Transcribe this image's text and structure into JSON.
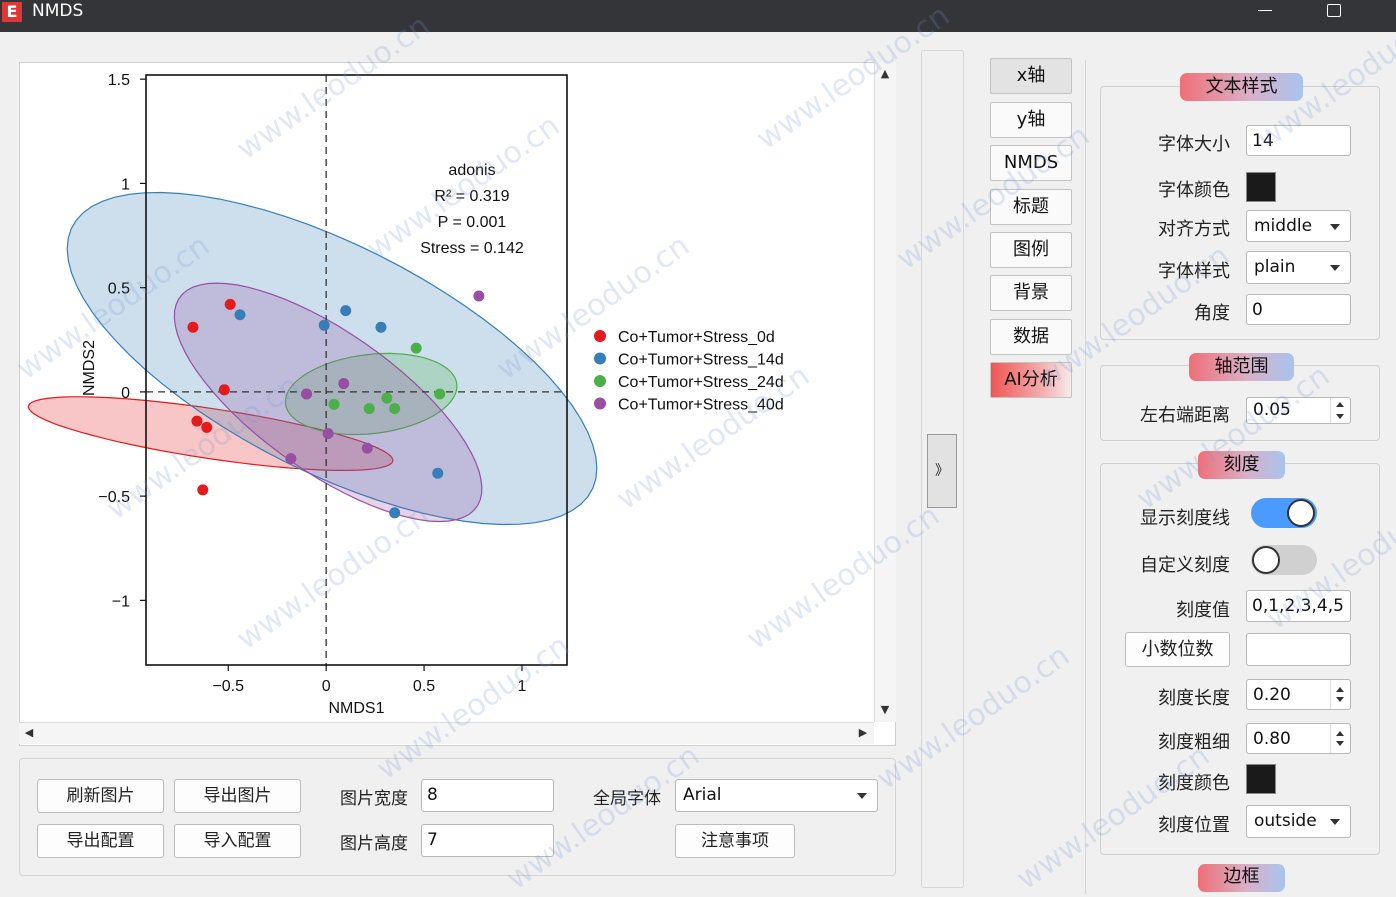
{
  "window": {
    "logo": "E",
    "title": "NMDS"
  },
  "chart_data": {
    "type": "scatter",
    "xlabel": "NMDS1",
    "ylabel": "NMDS2",
    "xlim": [
      -0.92,
      1.23
    ],
    "ylim": [
      -1.31,
      1.52
    ],
    "xticks": [
      -0.5,
      0,
      0.5,
      1
    ],
    "xtick_labels": [
      "−0.5",
      "0",
      "0.5",
      "1"
    ],
    "yticks": [
      -1,
      -0.5,
      0,
      0.5,
      1,
      1.5
    ],
    "ytick_labels": [
      "−1",
      "−0.5",
      "0",
      "0.5",
      "1",
      "1.5"
    ],
    "annotation": [
      "adonis",
      "R² = 0.319",
      "P = 0.001",
      "Stress = 0.142"
    ],
    "series": [
      {
        "name": "Co+Tumor+Stress_0d",
        "color": "#e41a1c",
        "points": [
          [
            -0.68,
            0.31
          ],
          [
            -0.49,
            0.42
          ],
          [
            -0.52,
            0.01
          ],
          [
            -0.66,
            -0.14
          ],
          [
            -0.61,
            -0.17
          ],
          [
            -0.63,
            -0.47
          ]
        ],
        "ellipse": {
          "cx": -0.59,
          "cy": -0.2,
          "rx": 0.12,
          "ry": 0.94,
          "angle": 82
        }
      },
      {
        "name": "Co+Tumor+Stress_14d",
        "color": "#377eb8",
        "points": [
          [
            -0.44,
            0.37
          ],
          [
            -0.01,
            0.32
          ],
          [
            0.1,
            0.39
          ],
          [
            0.28,
            0.31
          ],
          [
            0.57,
            -0.39
          ],
          [
            0.35,
            -0.58
          ]
        ],
        "ellipse": {
          "cx": 0.03,
          "cy": 0.16,
          "rx": 0.55,
          "ry": 1.47,
          "angle": 65
        }
      },
      {
        "name": "Co+Tumor+Stress_24d",
        "color": "#4daf4a",
        "points": [
          [
            -0.1,
            -0.01
          ],
          [
            0.04,
            -0.06
          ],
          [
            0.22,
            -0.08
          ],
          [
            0.31,
            -0.03
          ],
          [
            0.35,
            -0.08
          ],
          [
            0.46,
            0.21
          ],
          [
            0.58,
            -0.01
          ]
        ],
        "ellipse": {
          "cx": 0.23,
          "cy": -0.01,
          "rx": 0.44,
          "ry": 0.19,
          "angle": 6
        }
      },
      {
        "name": "Co+Tumor+Stress_40d",
        "color": "#984ea3",
        "points": [
          [
            0.78,
            0.46
          ],
          [
            0.09,
            0.04
          ],
          [
            -0.1,
            -0.01
          ],
          [
            0.01,
            -0.2
          ],
          [
            0.21,
            -0.27
          ],
          [
            -0.18,
            -0.32
          ]
        ],
        "ellipse": {
          "cx": 0.01,
          "cy": -0.05,
          "rx": 0.34,
          "ry": 0.91,
          "angle": 57
        }
      }
    ]
  },
  "bottom": {
    "refresh": "刷新图片",
    "export_img": "导出图片",
    "export_cfg": "导出配置",
    "import_cfg": "导入配置",
    "width_label": "图片宽度",
    "width_value": "8",
    "height_label": "图片高度",
    "height_value": "7",
    "font_label": "全局字体",
    "font_value": "Arial",
    "notes": "注意事项"
  },
  "collapse_glyph": "》",
  "tabs": [
    "x轴",
    "y轴",
    "NMDS",
    "标题",
    "图例",
    "背景",
    "数据",
    "AI分析"
  ],
  "text_style": {
    "title": "文本样式",
    "size_label": "字体大小",
    "size_value": "14",
    "color_label": "字体颜色",
    "align_label": "对齐方式",
    "align_value": "middle",
    "style_label": "字体样式",
    "style_value": "plain",
    "angle_label": "角度",
    "angle_value": "0"
  },
  "axis_range": {
    "title": "轴范围",
    "margin_label": "左右端距离",
    "margin_value": "0.05"
  },
  "ticks": {
    "title": "刻度",
    "show_label": "显示刻度线",
    "show_on": true,
    "custom_label": "自定义刻度",
    "custom_on": false,
    "values_label": "刻度值",
    "values_value": "0,1,2,3,4,5",
    "decimals_button": "小数位数",
    "decimals_value": "",
    "length_label": "刻度长度",
    "length_value": "0.20",
    "width_label": "刻度粗细",
    "width_value": "0.80",
    "color_label": "刻度颜色",
    "position_label": "刻度位置",
    "position_value": "outside"
  },
  "border_title": "边框",
  "watermark": "www.leoduo.cn",
  "colors": {
    "accent_on": "#4b9bff",
    "toggle_off": "#d0d0d0",
    "ai_gradient_start": "#f05555"
  }
}
